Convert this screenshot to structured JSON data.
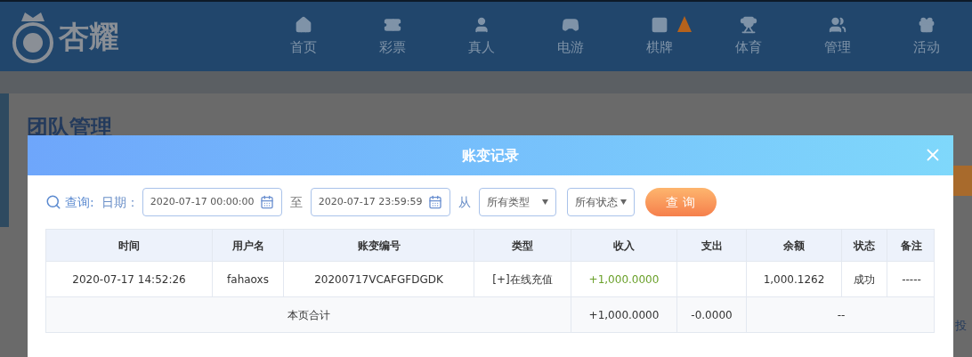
{
  "header": {
    "logo_text": "杏耀",
    "nav": [
      {
        "label": "首页",
        "badge": false
      },
      {
        "label": "彩票",
        "badge": false
      },
      {
        "label": "真人",
        "badge": false
      },
      {
        "label": "电游",
        "badge": false
      },
      {
        "label": "棋牌",
        "badge": true
      },
      {
        "label": "体育",
        "badge": false
      },
      {
        "label": "管理",
        "badge": false
      },
      {
        "label": "活动",
        "badge": false
      }
    ]
  },
  "page": {
    "title": "团队管理",
    "edge_text": "投"
  },
  "modal": {
    "title": "账变记录",
    "query": {
      "label": "查询:",
      "date_label": "日期：",
      "start": "2020-07-17 00:00:00",
      "to": "至",
      "end": "2020-07-17 23:59:59",
      "from": "从",
      "type_select": "所有类型",
      "status_select": "所有状态",
      "button": "查 询"
    },
    "table": {
      "columns": [
        "时间",
        "用户名",
        "账变编号",
        "类型",
        "收入",
        "支出",
        "余额",
        "状态",
        "备注"
      ],
      "rows": [
        [
          "2020-07-17 14:52:26",
          "fahaoxs",
          "20200717VCAFGFDGDK",
          "[+]在线充值",
          "+1,000.0000",
          "",
          "1,000.1262",
          "成功",
          "-----"
        ]
      ],
      "total": {
        "label": "本页合计",
        "income": "+1,000.0000",
        "expense": "-0.0000",
        "rest": "--"
      }
    }
  }
}
